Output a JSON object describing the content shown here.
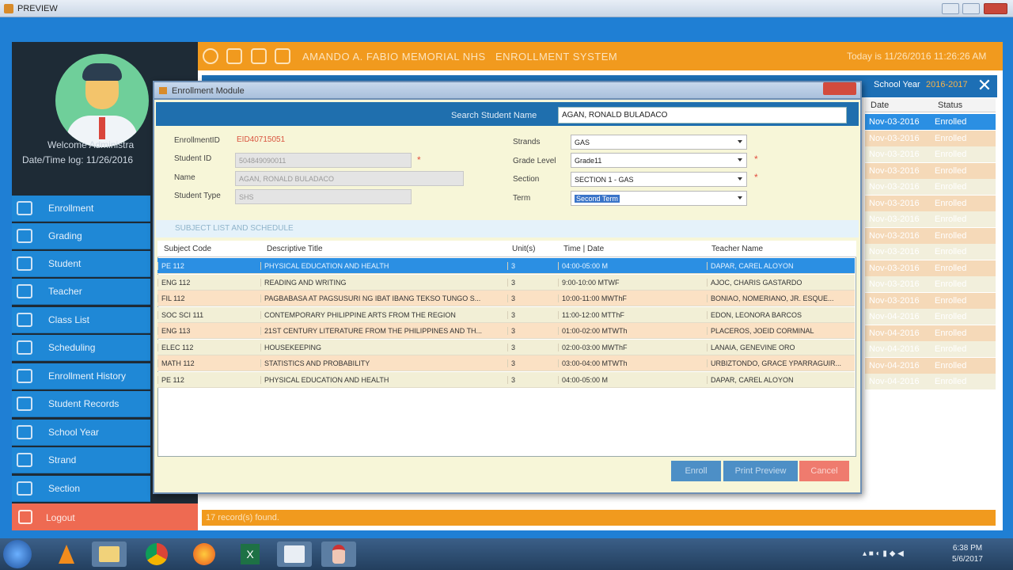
{
  "preview": {
    "title": "PREVIEW"
  },
  "app": {
    "school_name": "AMANDO A. FABIO MEMORIAL NHS",
    "system_name": "ENROLLMENT SYSTEM",
    "today": "Today is 11/26/2016 11:26:26 AM",
    "welcome": "Welcome Administra",
    "login_time": "Date/Time log: 11/26/2016",
    "nav": [
      "Enrollment",
      "Grading",
      "Student",
      "Teacher",
      "Class List",
      "Scheduling",
      "Enrollment History",
      "Student Records",
      "School Year",
      "Strand",
      "Section"
    ],
    "logout": "Logout",
    "school_year_label": "School Year",
    "school_year_value": "2016-2017",
    "bg_cols": {
      "date": "Date",
      "status": "Status"
    },
    "bg_rows": [
      {
        "date": "Nov-03-2016",
        "status": "Enrolled"
      },
      {
        "date": "Nov-03-2016",
        "status": "Enrolled"
      },
      {
        "date": "Nov-03-2016",
        "status": "Enrolled"
      },
      {
        "date": "Nov-03-2016",
        "status": "Enrolled"
      },
      {
        "date": "Nov-03-2016",
        "status": "Enrolled"
      },
      {
        "date": "Nov-03-2016",
        "status": "Enrolled"
      },
      {
        "date": "Nov-03-2016",
        "status": "Enrolled"
      },
      {
        "date": "Nov-03-2016",
        "status": "Enrolled"
      },
      {
        "date": "Nov-03-2016",
        "status": "Enrolled"
      },
      {
        "date": "Nov-03-2016",
        "status": "Enrolled"
      },
      {
        "date": "Nov-03-2016",
        "status": "Enrolled"
      },
      {
        "date": "Nov-03-2016",
        "status": "Enrolled"
      },
      {
        "date": "Nov-04-2016",
        "status": "Enrolled"
      },
      {
        "date": "Nov-04-2016",
        "status": "Enrolled"
      },
      {
        "date": "Nov-04-2016",
        "status": "Enrolled"
      },
      {
        "date": "Nov-04-2016",
        "status": "Enrolled"
      },
      {
        "date": "Nov-04-2016",
        "status": "Enrolled"
      }
    ],
    "records_found": "17   record(s) found."
  },
  "dialog": {
    "title": "Enrollment Module",
    "search_label": "Search Student Name",
    "search_value": "AGAN, RONALD BULADACO",
    "enrollment_id_label": "EnrollmentID",
    "enrollment_id_value": "EID40715051",
    "student_id_label": "Student ID",
    "student_id_value": "504849090011",
    "name_label": "Name",
    "name_value": "AGAN, RONALD BULADACO",
    "student_type_label": "Student Type",
    "student_type_value": "SHS",
    "strands_label": "Strands",
    "strands_value": "GAS",
    "grade_label": "Grade Level",
    "grade_value": "Grade11",
    "section_label": "Section",
    "section_value": "SECTION 1 - GAS",
    "term_label": "Term",
    "term_value": "Second Term",
    "subject_header": "SUBJECT LIST AND SCHEDULE",
    "columns": [
      "Subject Code",
      "Descriptive Title",
      "Unit(s)",
      "Time | Date",
      "Teacher Name"
    ],
    "rows": [
      {
        "code": "PE 112",
        "title": "PHYSICAL EDUCATION AND HEALTH",
        "units": "3",
        "time": "04:00-05:00 M",
        "teacher": "DAPAR, CAREL ALOYON"
      },
      {
        "code": "ENG 112",
        "title": "READING AND WRITING",
        "units": "3",
        "time": "9:00-10:00 MTWF",
        "teacher": "AJOC, CHARIS GASTARDO"
      },
      {
        "code": "FIL 112",
        "title": "PAGBABASA AT PAGSUSURI NG IBAT IBANG TEKSO TUNGO S...",
        "units": "3",
        "time": "10:00-11:00 MWThF",
        "teacher": "BONIAO, NOMERIANO, JR. ESQUE..."
      },
      {
        "code": "SOC SCI 111",
        "title": "CONTEMPORARY PHILIPPINE ARTS FROM THE REGION",
        "units": "3",
        "time": "11:00-12:00 MTThF",
        "teacher": "EDON, LEONORA BARCOS"
      },
      {
        "code": "ENG 113",
        "title": "21ST CENTURY LITERATURE FROM THE PHILIPPINES AND TH...",
        "units": "3",
        "time": "01:00-02:00 MTWTh",
        "teacher": "PLACEROS, JOEID CORMINAL"
      },
      {
        "code": "ELEC 112",
        "title": "HOUSEKEEPING",
        "units": "3",
        "time": "02:00-03:00 MWThF",
        "teacher": "LANAIA, GENEVINE ORO"
      },
      {
        "code": "MATH 112",
        "title": "STATISTICS AND PROBABILITY",
        "units": "3",
        "time": "03:00-04:00 MTWTh",
        "teacher": "URBIZTONDO, GRACE YPARRAGUIR..."
      },
      {
        "code": "PE 112",
        "title": "PHYSICAL EDUCATION AND HEALTH",
        "units": "3",
        "time": "04:00-05:00 M",
        "teacher": "DAPAR, CAREL ALOYON"
      }
    ],
    "btn_enroll": "Enroll",
    "btn_print": "Print Preview",
    "btn_cancel": "Cancel"
  },
  "taskbar": {
    "time": "6:38 PM",
    "date": "5/6/2017"
  }
}
